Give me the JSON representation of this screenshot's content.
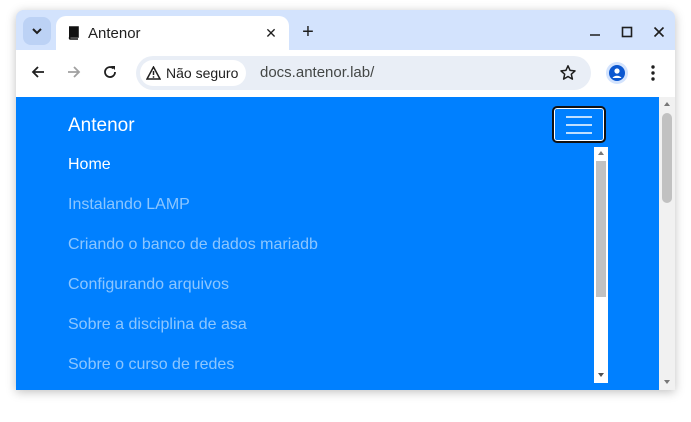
{
  "browser": {
    "tab_title": "Antenor",
    "security_label": "Não seguro",
    "url": "docs.antenor.lab/"
  },
  "site": {
    "brand": "Antenor",
    "nav_items": [
      {
        "label": "Home",
        "active": true
      },
      {
        "label": "Instalando LAMP",
        "active": false
      },
      {
        "label": "Criando o banco de dados mariadb",
        "active": false
      },
      {
        "label": "Configurando arquivos",
        "active": false
      },
      {
        "label": "Sobre a disciplina de asa",
        "active": false
      },
      {
        "label": "Sobre o curso de redes",
        "active": false
      }
    ]
  },
  "colors": {
    "tabstrip": "#d3e3fd",
    "page_background": "#0080ff",
    "nav_active": "#ffffff",
    "nav_muted": "rgba(255,255,255,0.55)"
  },
  "icons": [
    "tab-search-icon",
    "book-icon",
    "close-icon",
    "plus-icon",
    "minimize-icon",
    "maximize-icon",
    "back-icon",
    "forward-icon",
    "reload-icon",
    "warning-icon",
    "star-icon",
    "profile-icon",
    "kebab-menu-icon",
    "hamburger-icon"
  ]
}
